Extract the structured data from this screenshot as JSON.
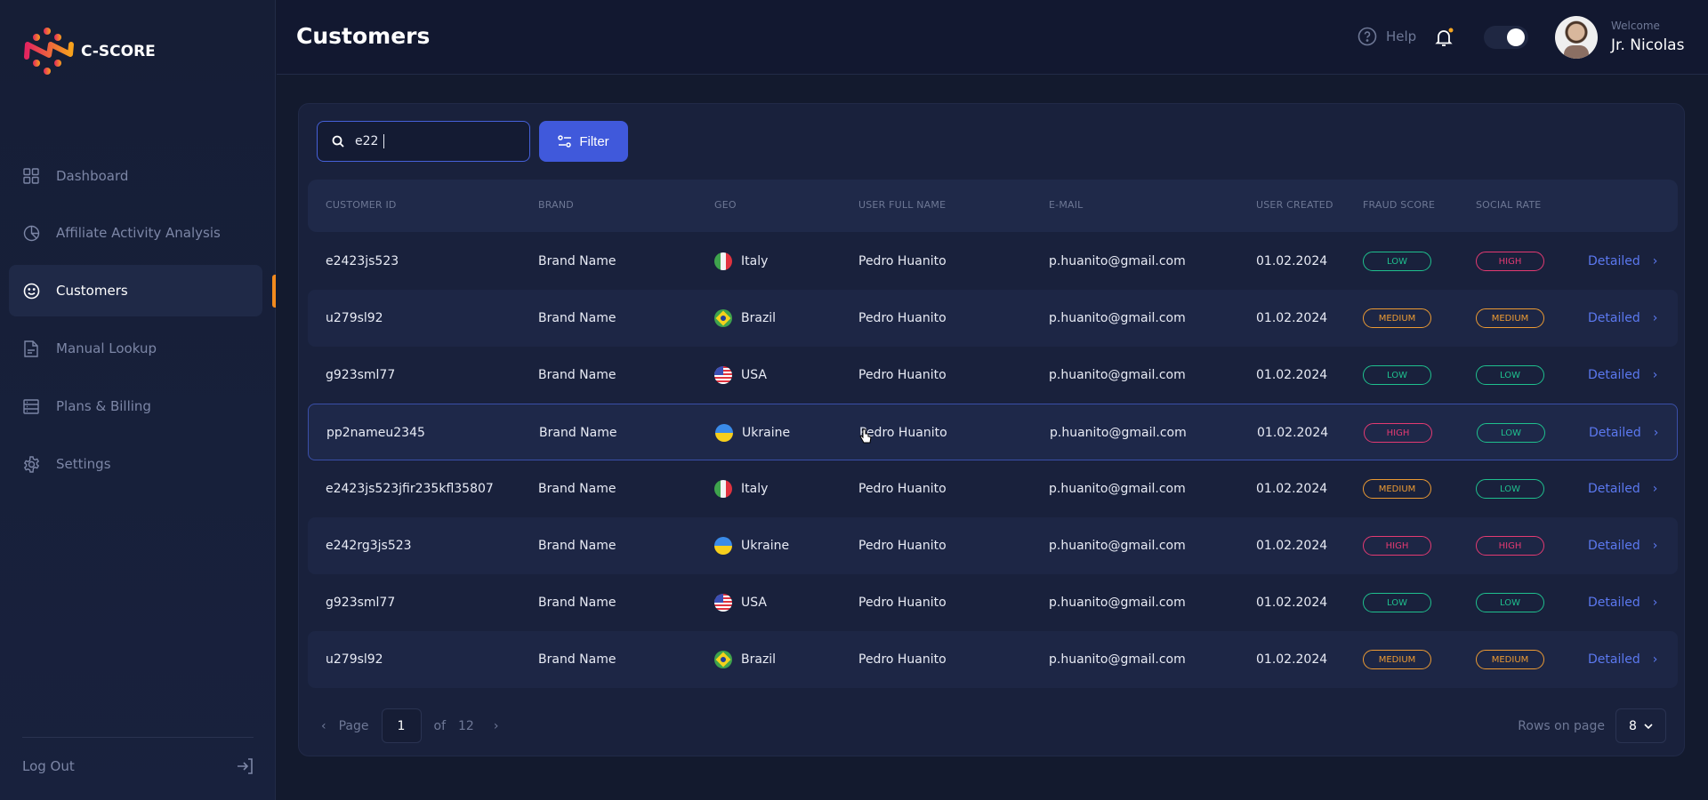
{
  "app": {
    "name": "C-SCORE"
  },
  "sidebar": {
    "items": [
      {
        "label": "Dashboard",
        "icon": "grid-icon"
      },
      {
        "label": "Affiliate Activity Analysis",
        "icon": "pie-chart-icon"
      },
      {
        "label": "Customers",
        "icon": "smile-icon",
        "active": true
      },
      {
        "label": "Manual Lookup",
        "icon": "document-icon"
      },
      {
        "label": "Plans & Billing",
        "icon": "list-icon"
      },
      {
        "label": "Settings",
        "icon": "gear-icon"
      }
    ],
    "logout": "Log Out"
  },
  "header": {
    "title": "Customers",
    "help": "Help",
    "welcome": "Welcome",
    "user": "Jr. Nicolas",
    "notification_dot": "#f5a623",
    "toggle_on": true
  },
  "search": {
    "value": "e22"
  },
  "filter_label": "Filter",
  "table": {
    "columns": [
      "CUSTOMER ID",
      "BRAND",
      "GEO",
      "USER FULL NAME",
      "E-MAIL",
      "USER CREATED",
      "FRAUD SCORE",
      "SOCIAL RATE"
    ],
    "rows": [
      {
        "id": "e2423js523",
        "brand": "Brand Name",
        "geo": "Italy",
        "name": "Pedro Huanito",
        "email": "p.huanito@gmail.com",
        "created": "01.02.2024",
        "fraud": "LOW",
        "social": "HIGH",
        "action": "Detailed"
      },
      {
        "id": "u279sl92",
        "brand": "Brand Name",
        "geo": "Brazil",
        "name": "Pedro Huanito",
        "email": "p.huanito@gmail.com",
        "created": "01.02.2024",
        "fraud": "MEDIUM",
        "social": "MEDIUM",
        "action": "Detailed"
      },
      {
        "id": "g923sml77",
        "brand": "Brand Name",
        "geo": "USA",
        "name": "Pedro Huanito",
        "email": "p.huanito@gmail.com",
        "created": "01.02.2024",
        "fraud": "LOW",
        "social": "LOW",
        "action": "Detailed"
      },
      {
        "id": "pp2nameu2345",
        "brand": "Brand Name",
        "geo": "Ukraine",
        "name": "Pedro Huanito",
        "email": "p.huanito@gmail.com",
        "created": "01.02.2024",
        "fraud": "HIGH",
        "social": "LOW",
        "action": "Detailed"
      },
      {
        "id": "e2423js523jfir235kfl35807",
        "brand": "Brand Name",
        "geo": "Italy",
        "name": "Pedro Huanito",
        "email": "p.huanito@gmail.com",
        "created": "01.02.2024",
        "fraud": "MEDIUM",
        "social": "LOW",
        "action": "Detailed"
      },
      {
        "id": "e242rg3js523",
        "brand": "Brand Name",
        "geo": "Ukraine",
        "name": "Pedro Huanito",
        "email": "p.huanito@gmail.com",
        "created": "01.02.2024",
        "fraud": "HIGH",
        "social": "HIGH",
        "action": "Detailed"
      },
      {
        "id": "g923sml77",
        "brand": "Brand Name",
        "geo": "USA",
        "name": "Pedro Huanito",
        "email": "p.huanito@gmail.com",
        "created": "01.02.2024",
        "fraud": "LOW",
        "social": "LOW",
        "action": "Detailed"
      },
      {
        "id": "u279sl92",
        "brand": "Brand Name",
        "geo": "Brazil",
        "name": "Pedro Huanito",
        "email": "p.huanito@gmail.com",
        "created": "01.02.2024",
        "fraud": "MEDIUM",
        "social": "MEDIUM",
        "action": "Detailed"
      }
    ]
  },
  "level_colors": {
    "LOW": "#1fc08e",
    "MEDIUM": "#eb9a33",
    "HIGH": "#e33a72"
  },
  "pagination": {
    "page_label": "Page",
    "page": "1",
    "of_label": "of",
    "total": "12",
    "rows_label": "Rows on page",
    "rows_value": "8"
  }
}
